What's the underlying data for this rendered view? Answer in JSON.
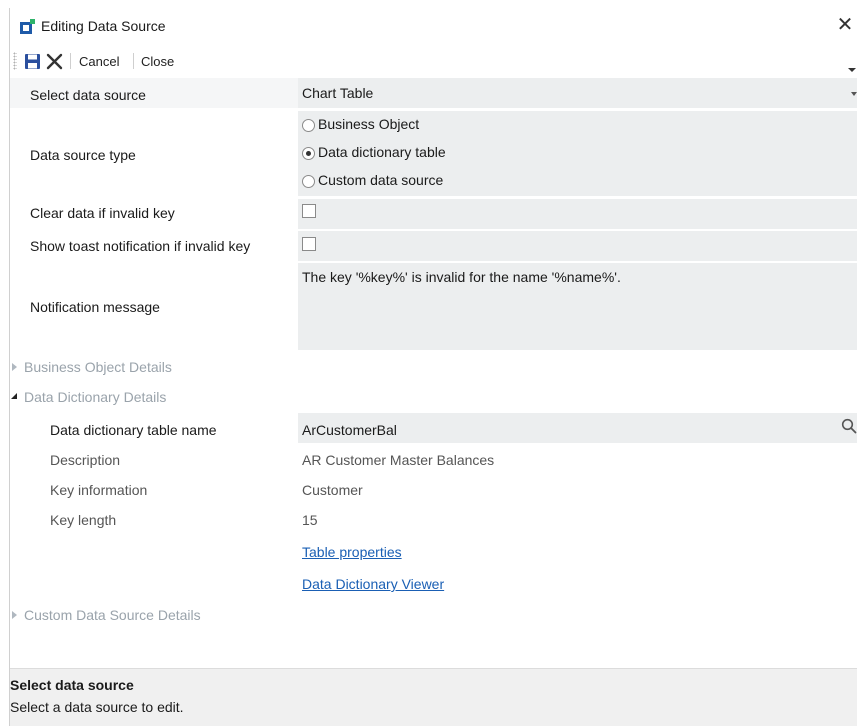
{
  "window": {
    "title": "Editing Data Source",
    "close_glyph": "✕"
  },
  "toolbar": {
    "save_icon": "save-icon",
    "delete_icon": "delete-icon",
    "cancel_label": "Cancel",
    "close_label": "Close"
  },
  "form": {
    "select_data_source": {
      "label": "Select data source",
      "value": "Chart Table"
    },
    "data_source_type": {
      "label": "Data source type",
      "options": [
        {
          "label": "Business Object",
          "checked": false
        },
        {
          "label": "Data dictionary table",
          "checked": true
        },
        {
          "label": "Custom data source",
          "checked": false
        }
      ]
    },
    "clear_data": {
      "label": "Clear data if invalid key",
      "checked": false
    },
    "show_toast": {
      "label": "Show toast notification if invalid key",
      "checked": false
    },
    "notification": {
      "label": "Notification message",
      "value": "The key '%key%' is invalid for the name '%name%'."
    }
  },
  "sections": {
    "business_object": {
      "title": "Business Object Details",
      "expanded": false
    },
    "data_dictionary": {
      "title": "Data Dictionary Details",
      "expanded": true
    },
    "custom": {
      "title": "Custom Data Source Details",
      "expanded": false
    }
  },
  "data_dictionary": {
    "table_name_label": "Data dictionary table name",
    "table_name_value": "ArCustomerBal",
    "description_label": "Description",
    "description_value": "AR Customer Master Balances",
    "key_info_label": "Key information",
    "key_info_value": "Customer",
    "key_length_label": "Key length",
    "key_length_value": "15",
    "link_table_properties": "Table properties",
    "link_viewer": "Data Dictionary Viewer"
  },
  "status": {
    "title": "Select data source",
    "description": "Select a data source to edit."
  },
  "colors": {
    "field_bg": "#eceeef",
    "link": "#1a5fb4",
    "section_header": "#9aa3ab",
    "save_icon": "#2b4f9e",
    "app_icon_green": "#2fb36a",
    "app_icon_blue": "#1e5aa8"
  }
}
